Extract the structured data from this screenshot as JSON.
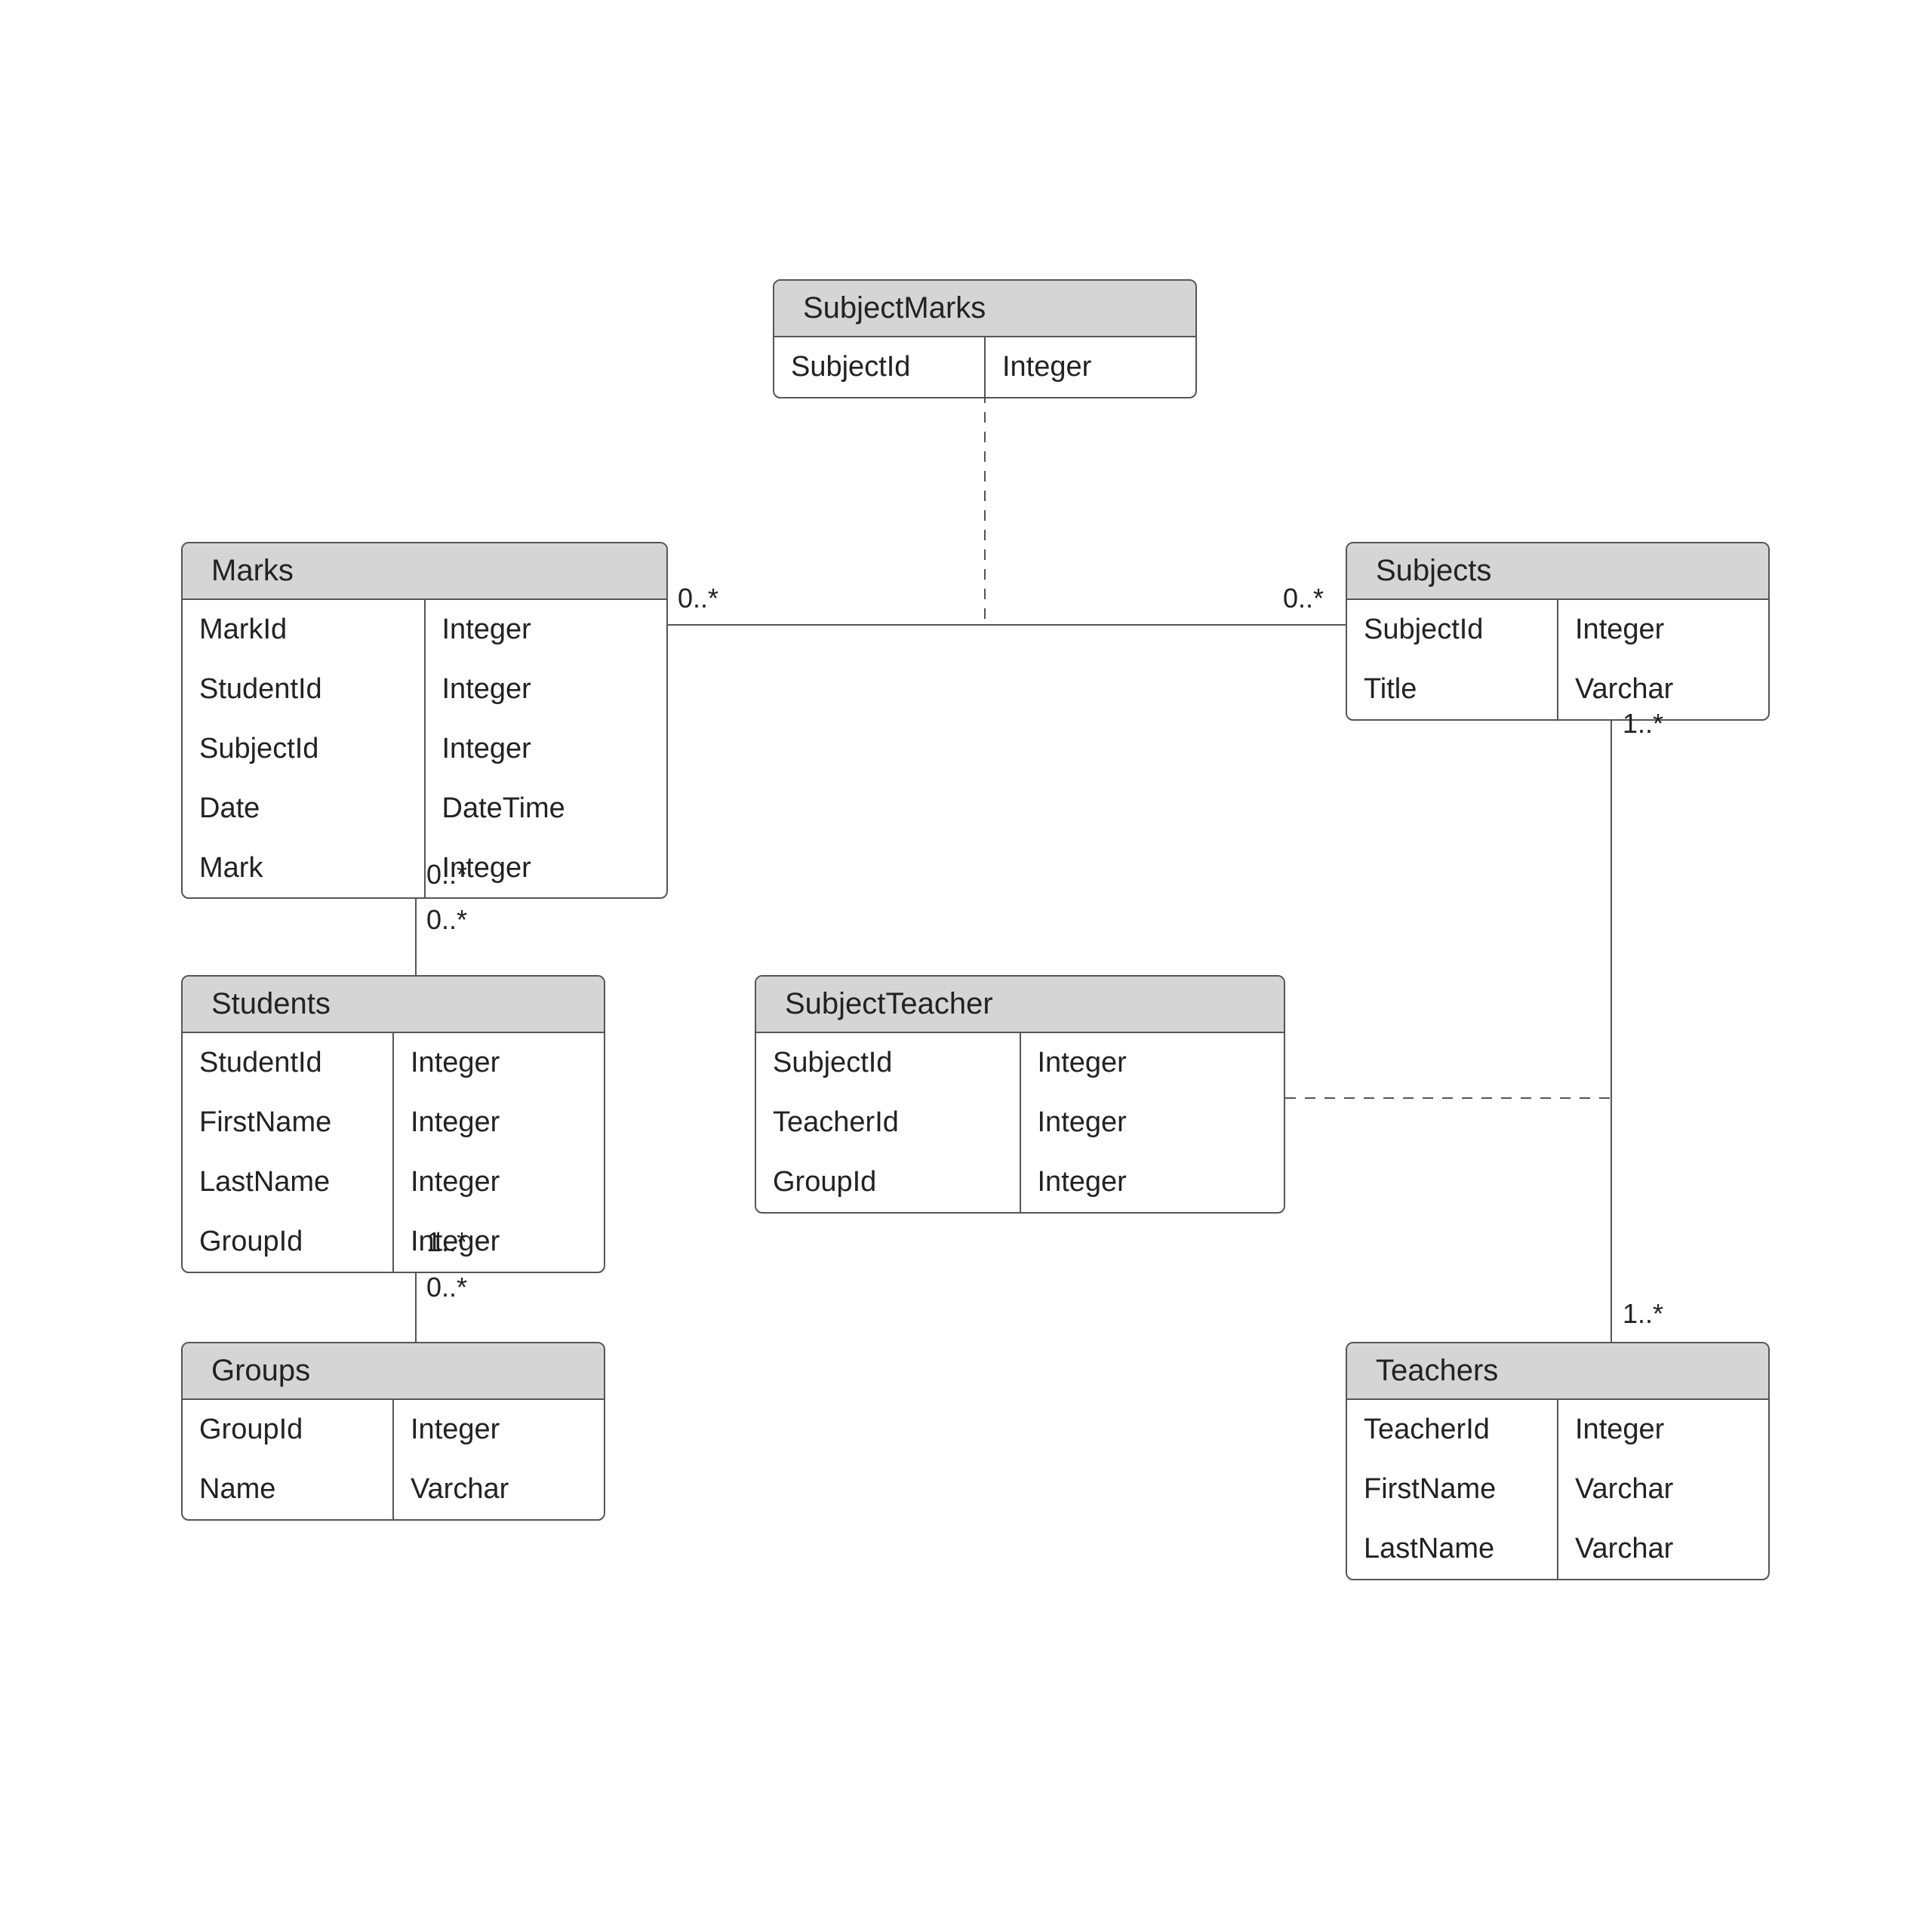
{
  "entities": {
    "subjectMarks": {
      "title": "SubjectMarks",
      "fields": [
        {
          "name": "SubjectId",
          "type": "Integer"
        }
      ]
    },
    "marks": {
      "title": "Marks",
      "fields": [
        {
          "name": "MarkId",
          "type": "Integer"
        },
        {
          "name": "StudentId",
          "type": "Integer"
        },
        {
          "name": "SubjectId",
          "type": "Integer"
        },
        {
          "name": "Date",
          "type": "DateTime"
        },
        {
          "name": "Mark",
          "type": "Integer"
        }
      ]
    },
    "subjects": {
      "title": "Subjects",
      "fields": [
        {
          "name": "SubjectId",
          "type": "Integer"
        },
        {
          "name": "Title",
          "type": "Varchar"
        }
      ]
    },
    "students": {
      "title": "Students",
      "fields": [
        {
          "name": "StudentId",
          "type": "Integer"
        },
        {
          "name": "FirstName",
          "type": "Integer"
        },
        {
          "name": "LastName",
          "type": "Integer"
        },
        {
          "name": "GroupId",
          "type": "Integer"
        }
      ]
    },
    "subjectTeacher": {
      "title": "SubjectTeacher",
      "fields": [
        {
          "name": "SubjectId",
          "type": "Integer"
        },
        {
          "name": "TeacherId",
          "type": "Integer"
        },
        {
          "name": "GroupId",
          "type": "Integer"
        }
      ]
    },
    "groups": {
      "title": "Groups",
      "fields": [
        {
          "name": "GroupId",
          "type": "Integer"
        },
        {
          "name": "Name",
          "type": "Varchar"
        }
      ]
    },
    "teachers": {
      "title": "Teachers",
      "fields": [
        {
          "name": "TeacherId",
          "type": "Integer"
        },
        {
          "name": "FirstName",
          "type": "Varchar"
        },
        {
          "name": "LastName",
          "type": "Varchar"
        }
      ]
    }
  },
  "multiplicities": {
    "marks_subjects_left": "0..*",
    "marks_subjects_right": "0..*",
    "marks_students_top": "0..*",
    "marks_students_bot": "0..*",
    "students_groups_top": "1..*",
    "students_groups_bot": "0..*",
    "subjects_teachers_top": "1..*",
    "subjects_teachers_bot": "1..*"
  }
}
